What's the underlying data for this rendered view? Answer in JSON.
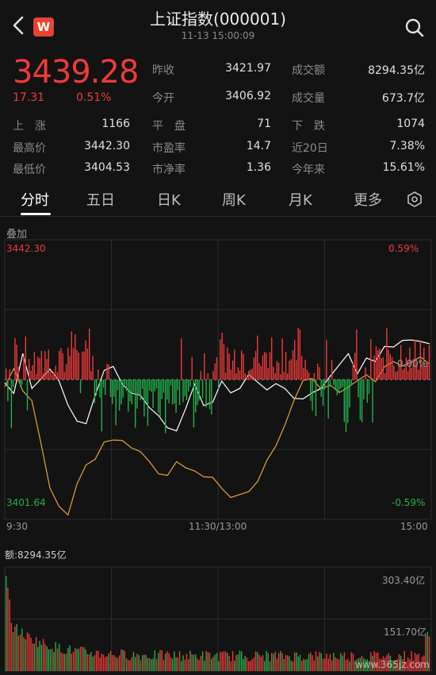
{
  "header": {
    "title": "上证指数(000001)",
    "datetime": "11-13 15:00:09",
    "logo_letter": "W"
  },
  "quote": {
    "price": "3439.28",
    "change": "17.31",
    "change_pct": "0.51%"
  },
  "stats": [
    {
      "label": "昨收",
      "value": "3421.97"
    },
    {
      "label": "成交额",
      "value": "8294.35亿"
    },
    {
      "label": "今开",
      "value": "3406.92"
    },
    {
      "label": "成交量",
      "value": "673.7亿"
    },
    {
      "label": "上　涨",
      "value": "1166"
    },
    {
      "label": "平　盘",
      "value": "71"
    },
    {
      "label": "下　跌",
      "value": "1074"
    },
    {
      "label": "最高价",
      "value": "3442.30"
    },
    {
      "label": "市盈率",
      "value": "14.7"
    },
    {
      "label": "近20日",
      "value": "7.38%"
    },
    {
      "label": "最低价",
      "value": "3404.53"
    },
    {
      "label": "市净率",
      "value": "1.36"
    },
    {
      "label": "今年来",
      "value": "15.61%"
    }
  ],
  "tabs": [
    "分时",
    "五日",
    "日K",
    "周K",
    "月K",
    "更多"
  ],
  "overlay_label": "叠加",
  "chart": {
    "y_top_label": "3442.30",
    "y_top_pct": "0.59%",
    "y_bottom_label": "3401.64",
    "y_bottom_pct": "-0.59%",
    "mid_pct": "0.00%",
    "x_labels": [
      "9:30",
      "11:30/13:00",
      "15:00"
    ],
    "volume_label": "额:8294.35亿",
    "vol_top": "303.40亿",
    "vol_mid": "151.70亿"
  },
  "watermark": "www.365jz.com",
  "colors": {
    "up": "#f03a3a",
    "down": "#22b14c",
    "bg": "#131313",
    "price_line": "#ffffff",
    "avg_line": "#e6a23c"
  },
  "chart_data": {
    "type": "line",
    "ylim": [
      3401.64,
      3442.3
    ],
    "series": [
      {
        "values": [
          3421.5,
          3420.0,
          3425.5,
          3420.5,
          3422.0,
          3423.5,
          3421.5,
          3418.5,
          3416.0,
          3415.5,
          3419.5,
          3423.5,
          3424.0,
          3421.0,
          3420.0,
          3419.5,
          3418.0,
          3416.5,
          3415.0,
          3414.5,
          3417.5,
          3421.0,
          3418.5,
          3419.0,
          3421.5,
          3420.0,
          3421.0,
          3422.5,
          3421.5,
          3420.5,
          3421.5,
          3420.5,
          3419.0,
          3419.5,
          3420.0,
          3420.5,
          3422.5,
          3424.0,
          3425.5,
          3423.0,
          3425.0,
          3424.5,
          3426.5,
          3427.0,
          3427.5,
          3428.0,
          3427.5,
          3427.0
        ]
      },
      {
        "values": [
          3421.0,
          3423.5,
          3420.5,
          3419.0,
          3412.5,
          3406.0,
          3403.5,
          3402.0,
          3406.5,
          3409.5,
          3410.5,
          3413.0,
          3413.5,
          3413.0,
          3412.0,
          3411.5,
          3410.0,
          3408.5,
          3408.0,
          3410.0,
          3409.0,
          3408.5,
          3408.0,
          3407.5,
          3406.0,
          3405.0,
          3405.5,
          3406.0,
          3407.5,
          3410.5,
          3412.5,
          3415.5,
          3419.0,
          3421.5,
          3422.0,
          3420.5,
          3421.0,
          3420.0,
          3421.0,
          3422.0,
          3422.5,
          3422.0,
          3423.5,
          3424.5,
          3424.0,
          3424.5,
          3425.0,
          3424.5
        ]
      }
    ]
  }
}
